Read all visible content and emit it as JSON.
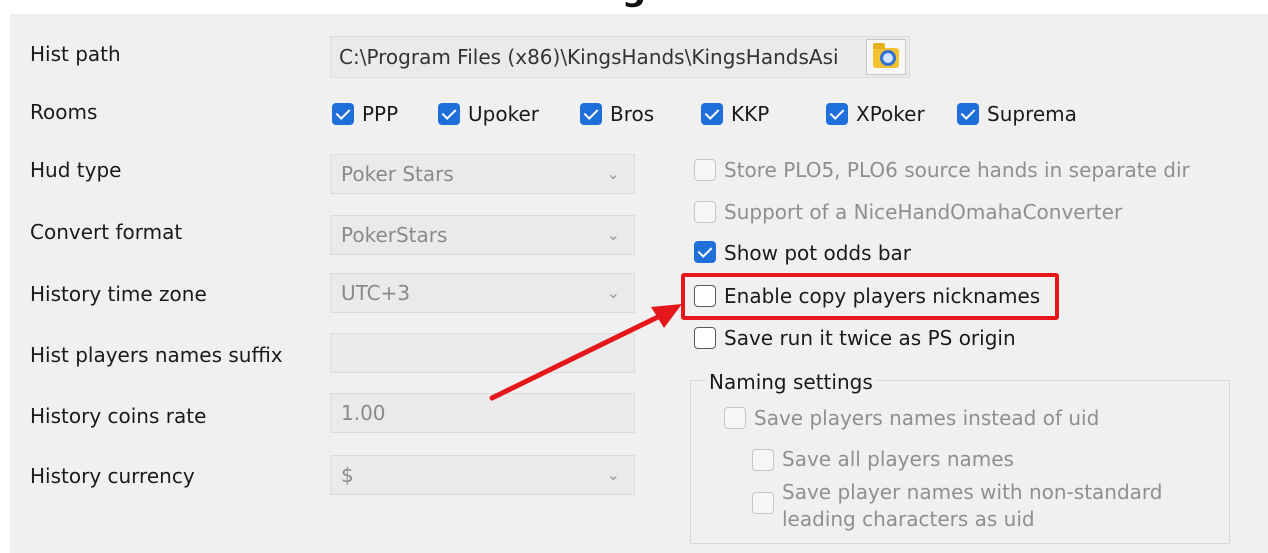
{
  "header": {
    "title_fragment": "g"
  },
  "hist_path": {
    "label": "Hist path",
    "value": "C:\\Program Files (x86)\\KingsHands\\KingsHandsAsi",
    "browse_icon": "folder-search-icon"
  },
  "rooms": {
    "label": "Rooms",
    "items": [
      {
        "label": "PPP",
        "checked": true
      },
      {
        "label": "Upoker",
        "checked": true
      },
      {
        "label": "Bros",
        "checked": true
      },
      {
        "label": "KKP",
        "checked": true
      },
      {
        "label": "XPoker",
        "checked": true
      },
      {
        "label": "Suprema",
        "checked": true
      }
    ]
  },
  "fields": {
    "hud_type": {
      "label": "Hud type",
      "value": "Poker Stars"
    },
    "convert_format": {
      "label": "Convert format",
      "value": "PokerStars"
    },
    "time_zone": {
      "label": "History time zone",
      "value": "UTC+3"
    },
    "names_suffix": {
      "label": "Hist players names suffix",
      "value": ""
    },
    "coins_rate": {
      "label": "History coins rate",
      "value": "1.00"
    },
    "currency": {
      "label": "History currency",
      "value": "$"
    }
  },
  "options": {
    "store_plo": {
      "label": "Store PLO5, PLO6 source hands in separate dir",
      "checked": false,
      "enabled": false
    },
    "nice_hand": {
      "label": "Support of a NiceHandOmahaConverter",
      "checked": false,
      "enabled": false
    },
    "pot_odds": {
      "label": "Show pot odds bar",
      "checked": true,
      "enabled": true
    },
    "copy_nicknames": {
      "label": "Enable copy players nicknames",
      "checked": false,
      "enabled": true
    },
    "run_it_twice": {
      "label": "Save run it twice as PS origin",
      "checked": false,
      "enabled": true
    }
  },
  "naming": {
    "title": "Naming settings",
    "names_instead_uid": {
      "label": "Save players names instead of uid",
      "checked": false,
      "enabled": false
    },
    "all_names": {
      "label": "Save all players names",
      "checked": false,
      "enabled": false
    },
    "nonstandard_line1": "Save player names with non-standard",
    "nonstandard_line2": "leading characters as uid"
  },
  "colors": {
    "accent": "#1e6fd9",
    "highlight": "#e5171b",
    "panel": "#f0f0f0"
  }
}
